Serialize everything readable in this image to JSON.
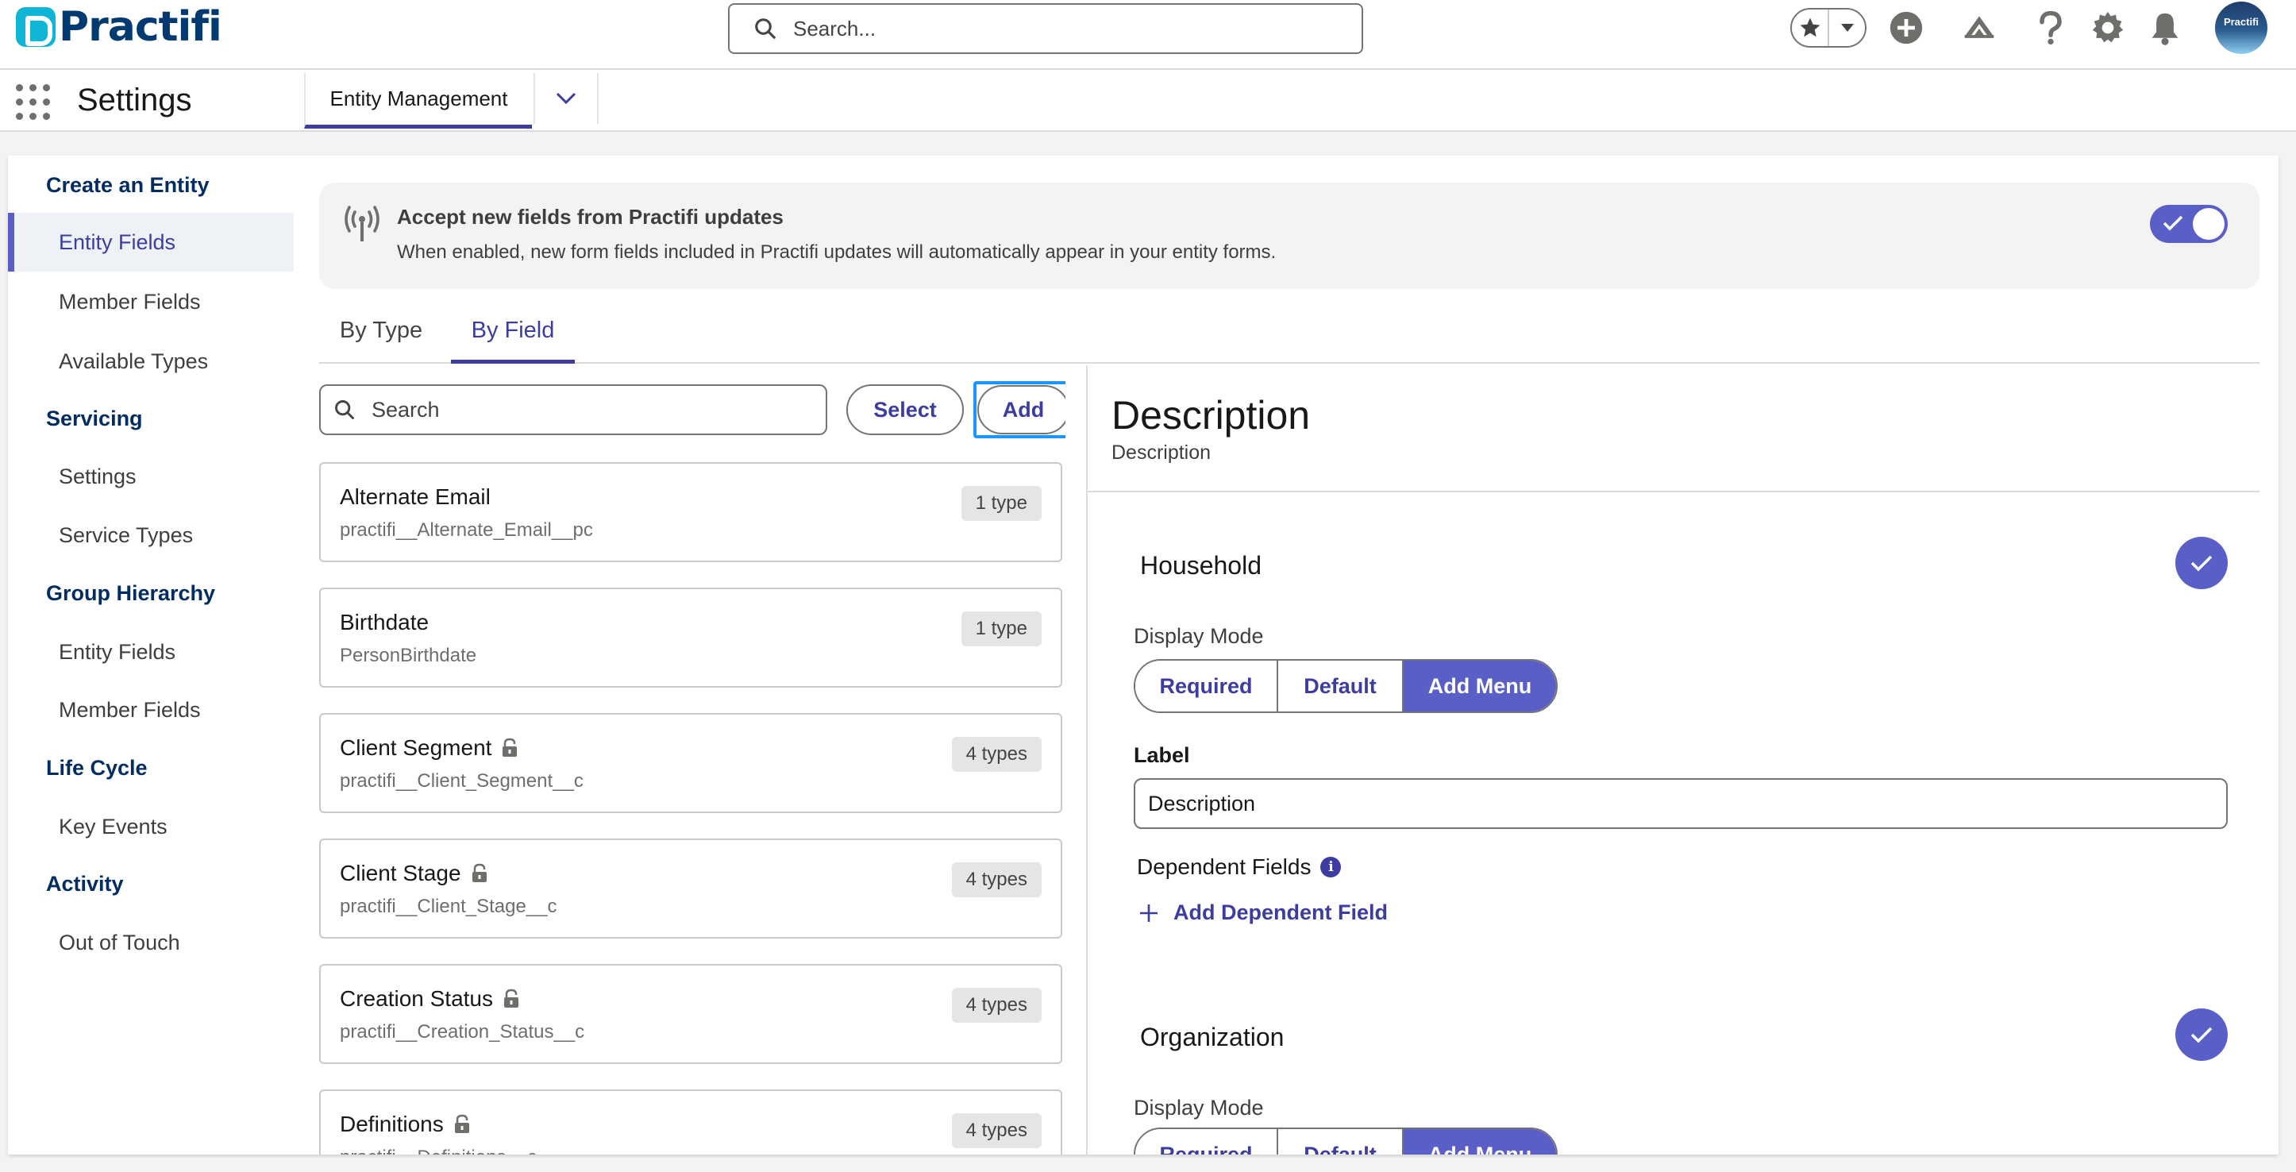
{
  "header": {
    "logo_text": "Practifi",
    "search_placeholder": "Search...",
    "avatar_text": "Practifi"
  },
  "navbar": {
    "app_name": "Settings",
    "tab_label": "Entity Management"
  },
  "sidebar": {
    "sections": [
      {
        "heading": "Create an Entity",
        "items": [
          "Entity Fields",
          "Member Fields",
          "Available Types"
        ]
      },
      {
        "heading": "Servicing",
        "items": [
          "Settings",
          "Service Types"
        ]
      },
      {
        "heading": "Group Hierarchy",
        "items": [
          "Entity Fields",
          "Member Fields"
        ]
      },
      {
        "heading": "Life Cycle",
        "items": [
          "Key Events"
        ]
      },
      {
        "heading": "Activity",
        "items": [
          "Out of Touch"
        ]
      }
    ],
    "active_item": "Entity Fields"
  },
  "banner": {
    "title": "Accept new fields from Practifi updates",
    "description": "When enabled, new form fields included in Practifi updates will automatically appear in your entity forms.",
    "toggle_on": true
  },
  "tabs": [
    "By Type",
    "By Field"
  ],
  "field_list": {
    "search_placeholder": "Search",
    "select_label": "Select",
    "add_label": "Add",
    "fields": [
      {
        "name": "Alternate Email",
        "api": "practifi__Alternate_Email__pc",
        "types": "1 type",
        "locked": false
      },
      {
        "name": "Birthdate",
        "api": "PersonBirthdate",
        "types": "1 type",
        "locked": false
      },
      {
        "name": "Client Segment",
        "api": "practifi__Client_Segment__c",
        "types": "4 types",
        "locked": true
      },
      {
        "name": "Client Stage",
        "api": "practifi__Client_Stage__c",
        "types": "4 types",
        "locked": true
      },
      {
        "name": "Creation Status",
        "api": "practifi__Creation_Status__c",
        "types": "4 types",
        "locked": true
      },
      {
        "name": "Definitions",
        "api": "practifi__Definitions__c",
        "types": "4 types",
        "locked": true
      }
    ]
  },
  "detail": {
    "title": "Description",
    "subtitle": "Description",
    "sections": [
      {
        "name": "Household",
        "display_mode_label": "Display Mode",
        "modes": [
          "Required",
          "Default",
          "Add Menu"
        ],
        "selected_mode": "Add Menu",
        "label_heading": "Label",
        "label_value": "Description",
        "dependent_label": "Dependent Fields",
        "add_dependent_label": "Add Dependent Field"
      },
      {
        "name": "Organization",
        "display_mode_label": "Display Mode",
        "modes": [
          "Required",
          "Default",
          "Add Menu"
        ],
        "selected_mode": "Add Menu"
      }
    ]
  },
  "colors": {
    "brand_purple": "#5a5fc8",
    "link_purple": "#3c3d9e",
    "logo_teal": "#0fb5d6",
    "logo_navy": "#003a70"
  }
}
